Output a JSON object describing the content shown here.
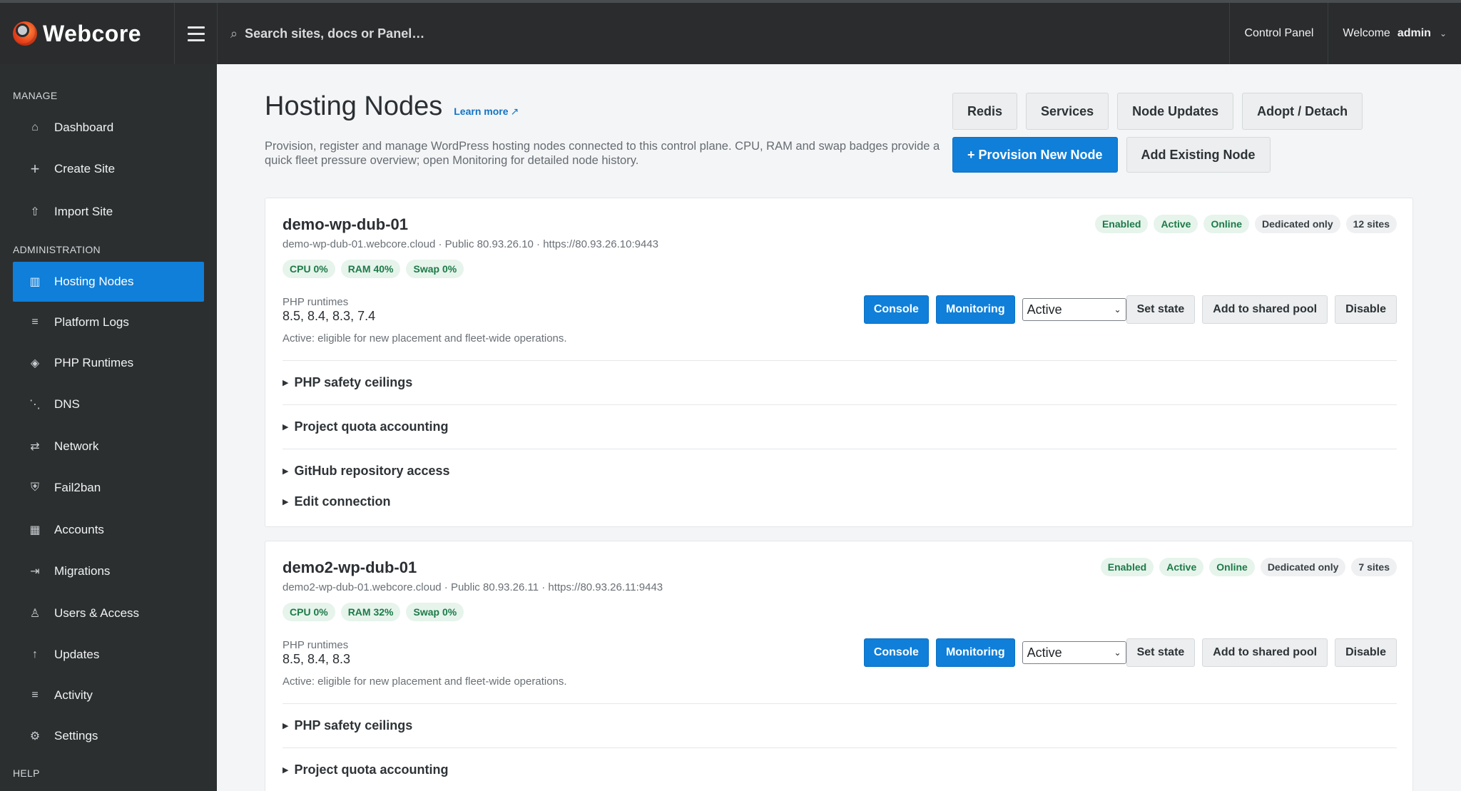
{
  "app": {
    "brand": "Webcore",
    "search_placeholder": "Search sites, docs or Panel…",
    "control_panel": "Control Panel",
    "welcome": "Welcome",
    "username": "admin"
  },
  "sidebar": {
    "manage_label": "MANAGE",
    "manage_items": [
      {
        "label": "Dashboard",
        "icon": "home-icon"
      },
      {
        "label": "Create Site",
        "icon": "plus-icon"
      },
      {
        "label": "Import Site",
        "icon": "upload-icon"
      }
    ],
    "admin_label": "ADMINISTRATION",
    "admin_items": [
      {
        "label": "Hosting Nodes",
        "icon": "server-icon",
        "active": true
      },
      {
        "label": "Platform Logs",
        "icon": "list-icon"
      },
      {
        "label": "PHP Runtimes",
        "icon": "diamond-icon"
      },
      {
        "label": "DNS",
        "icon": "dns-icon"
      },
      {
        "label": "Network",
        "icon": "arrows-icon"
      },
      {
        "label": "Fail2ban",
        "icon": "shield-icon"
      },
      {
        "label": "Accounts",
        "icon": "grid-icon"
      },
      {
        "label": "Migrations",
        "icon": "arrow-right-bar-icon"
      },
      {
        "label": "Users & Access",
        "icon": "user-icon"
      },
      {
        "label": "Updates",
        "icon": "arrow-up-icon"
      },
      {
        "label": "Activity",
        "icon": "activity-list-icon"
      },
      {
        "label": "Settings",
        "icon": "gear-icon"
      }
    ],
    "help_label": "HELP"
  },
  "page": {
    "title": "Hosting Nodes",
    "learn_more": "Learn more",
    "description": "Provision, register and manage WordPress hosting nodes connected to this control plane. CPU, RAM and swap badges provide a quick fleet pressure overview; open Monitoring for detailed node history.",
    "buttons_row1": [
      "Redis",
      "Services",
      "Node Updates",
      "Adopt / Detach"
    ],
    "provision_button": "+ Provision New Node",
    "add_existing_button": "Add Existing Node"
  },
  "nodes": [
    {
      "name": "demo-wp-dub-01",
      "meta": "demo-wp-dub-01.webcore.cloud · Public 80.93.26.10 · https://80.93.26.10:9443",
      "metrics": [
        "CPU 0%",
        "RAM 40%",
        "Swap 0%"
      ],
      "badges": [
        "Enabled",
        "Active",
        "Online",
        "Dedicated only",
        "12 sites"
      ],
      "php_label": "PHP runtimes",
      "php_value": "8.5, 8.4, 8.3, 7.4",
      "state_desc": "Active: eligible for new placement and fleet-wide operations.",
      "console": "Console",
      "monitoring": "Monitoring",
      "state": "Active",
      "set_state": "Set state",
      "shared_pool": "Add to shared pool",
      "disable": "Disable",
      "sections": [
        "PHP safety ceilings",
        "Project quota accounting",
        "GitHub repository access",
        "Edit connection"
      ]
    },
    {
      "name": "demo2-wp-dub-01",
      "meta": "demo2-wp-dub-01.webcore.cloud · Public 80.93.26.11 · https://80.93.26.11:9443",
      "metrics": [
        "CPU 0%",
        "RAM 32%",
        "Swap 0%"
      ],
      "badges": [
        "Enabled",
        "Active",
        "Online",
        "Dedicated only",
        "7 sites"
      ],
      "php_label": "PHP runtimes",
      "php_value": "8.5, 8.4, 8.3",
      "state_desc": "Active: eligible for new placement and fleet-wide operations.",
      "console": "Console",
      "monitoring": "Monitoring",
      "state": "Active",
      "set_state": "Set state",
      "shared_pool": "Add to shared pool",
      "disable": "Disable",
      "sections": [
        "PHP safety ceilings",
        "Project quota accounting"
      ]
    }
  ],
  "colors": {
    "accent": "#0f7fd9",
    "topbar": "#2a2c2d",
    "sidebar": "#2c2f30",
    "badge_green_bg": "#e6f4ec",
    "badge_green_text": "#1d7a47"
  }
}
